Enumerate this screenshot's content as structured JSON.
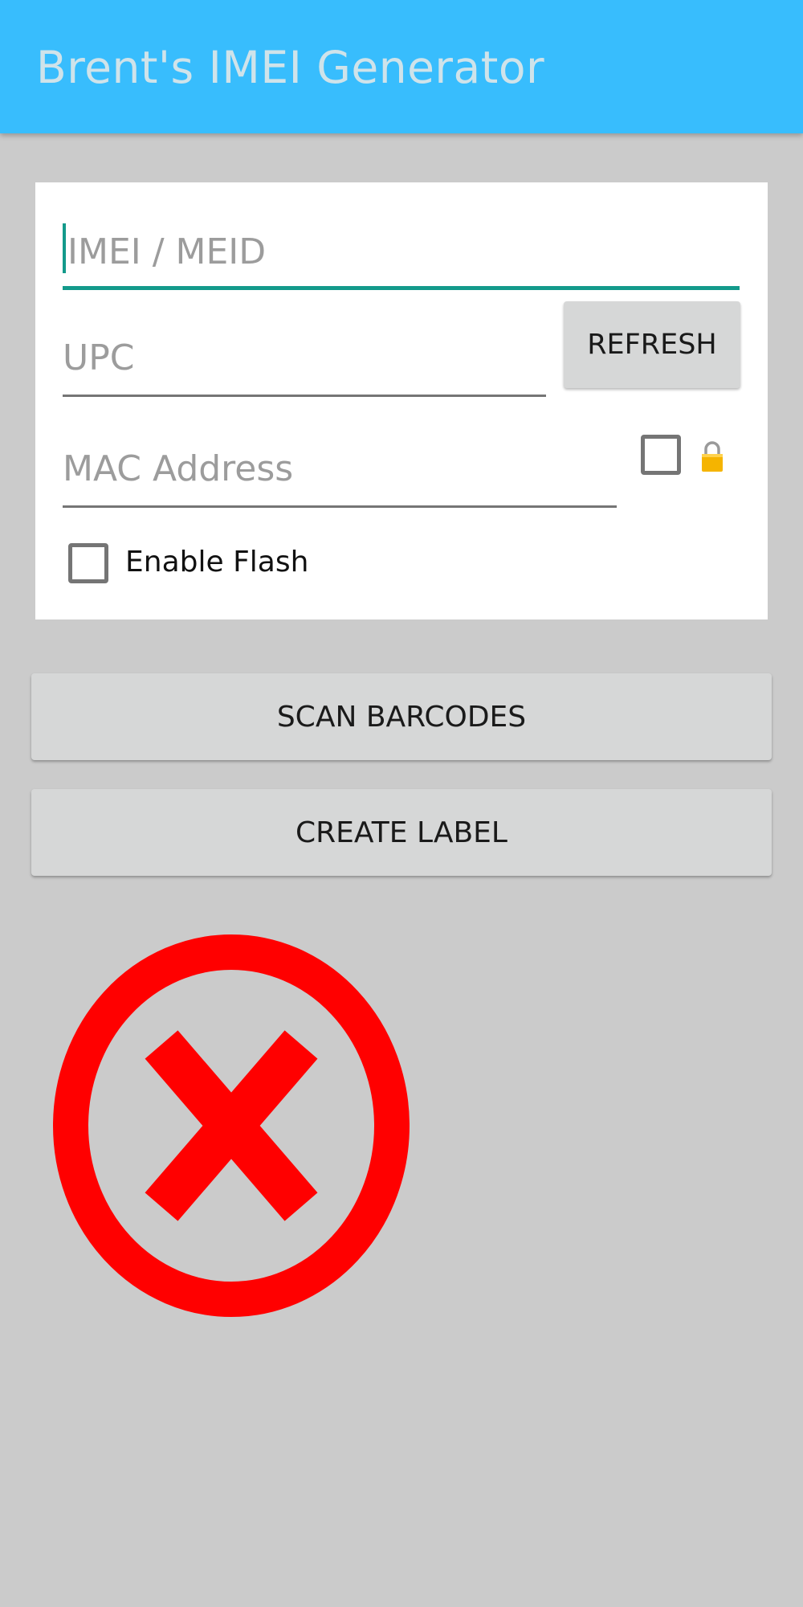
{
  "app_bar": {
    "title": "Brent's IMEI Generator",
    "color": "#38bdfd"
  },
  "form": {
    "imei": {
      "value": "",
      "placeholder": "IMEI / MEID",
      "focused": true
    },
    "upc": {
      "value": "",
      "placeholder": "UPC"
    },
    "refresh_label": "REFRESH",
    "mac": {
      "value": "",
      "placeholder": "MAC Address"
    },
    "mac_lock": {
      "checked": false,
      "icon": "lock-icon"
    },
    "flash": {
      "label": "Enable Flash",
      "checked": false
    }
  },
  "actions": {
    "scan_label": "SCAN BARCODES",
    "create_label": "CREATE LABEL"
  },
  "status": {
    "icon": "error-x-circle-icon",
    "color": "#ff0000"
  },
  "colors": {
    "background": "#cbcbcb",
    "accent": "#139a8b"
  }
}
